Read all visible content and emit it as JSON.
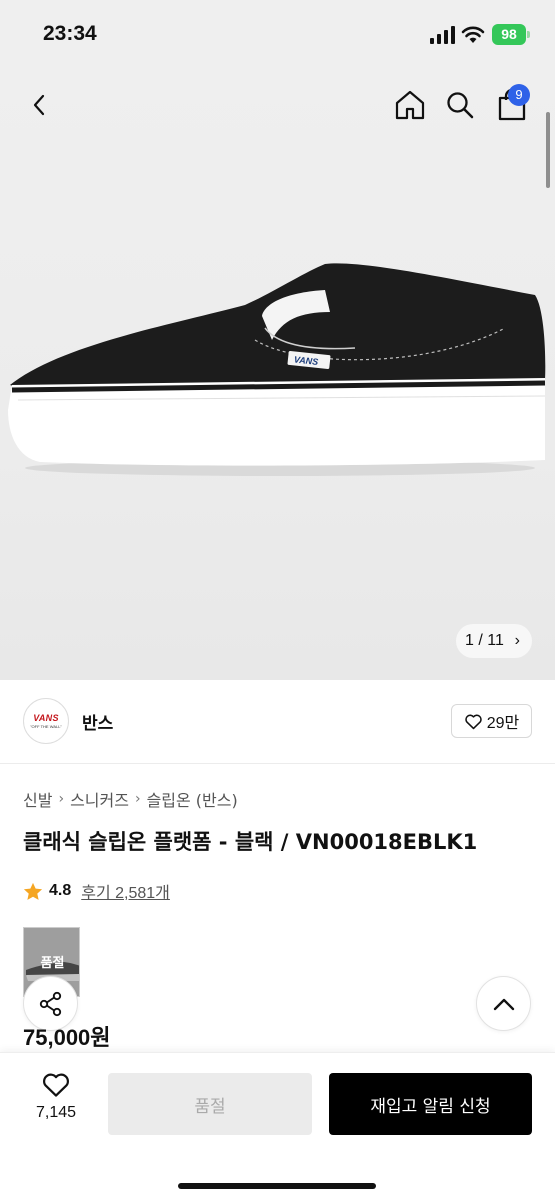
{
  "status_bar": {
    "time": "23:34",
    "battery": "98"
  },
  "nav": {
    "cart_count": "9"
  },
  "gallery": {
    "pager": "1 / 11"
  },
  "brand": {
    "logo_text": "VANS",
    "logo_tagline": "\"OFF THE WALL\"",
    "name": "반스",
    "likes": "29만"
  },
  "breadcrumb": [
    "신발",
    "스니커즈",
    "슬립온 (반스)"
  ],
  "product": {
    "title": "클래식 슬립온 플랫폼 - 블랙 / VN00018EBLK1",
    "rating": "4.8",
    "reviews": "후기 2,581개",
    "price": "75,000원",
    "thumb_label": "품절"
  },
  "bottom": {
    "wish_count": "7,145",
    "soldout_label": "품절",
    "restock_label": "재입고 알림 신청"
  },
  "colors": {
    "accent_blue": "#2f62e8",
    "star": "#f5a623",
    "battery": "#34c759"
  },
  "icons": [
    "back-icon",
    "home-icon",
    "search-icon",
    "shopping-bag-icon",
    "heart-icon",
    "star-icon",
    "share-icon",
    "chevron-up-icon",
    "chevron-right-icon"
  ]
}
